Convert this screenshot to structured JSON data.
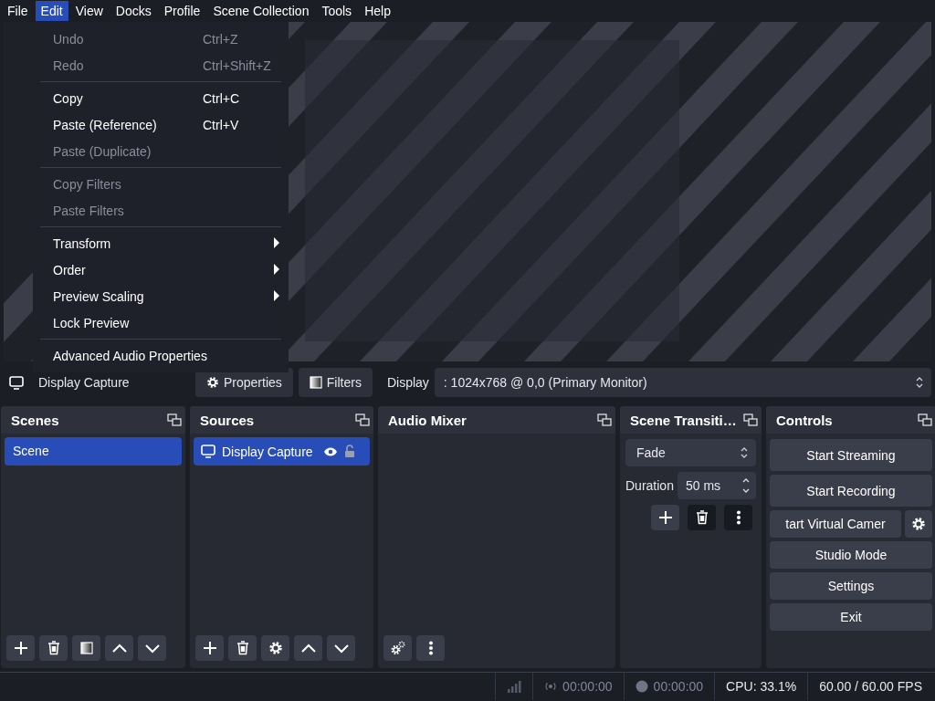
{
  "menubar": [
    {
      "label": "File",
      "selected": false
    },
    {
      "label": "Edit",
      "selected": true
    },
    {
      "label": "View",
      "selected": false
    },
    {
      "label": "Docks",
      "selected": false
    },
    {
      "label": "Profile",
      "selected": false
    },
    {
      "label": "Scene Collection",
      "selected": false
    },
    {
      "label": "Tools",
      "selected": false
    },
    {
      "label": "Help",
      "selected": false
    }
  ],
  "edit_menu": {
    "items": [
      {
        "kind": "item",
        "label": "Undo",
        "shortcut": "Ctrl+Z",
        "disabled": true,
        "submenu": false
      },
      {
        "kind": "item",
        "label": "Redo",
        "shortcut": "Ctrl+Shift+Z",
        "disabled": true,
        "submenu": false
      },
      {
        "kind": "separator"
      },
      {
        "kind": "item",
        "label": "Copy",
        "shortcut": "Ctrl+C",
        "disabled": false,
        "submenu": false
      },
      {
        "kind": "item",
        "label": "Paste (Reference)",
        "shortcut": "Ctrl+V",
        "disabled": false,
        "submenu": false
      },
      {
        "kind": "item",
        "label": "Paste (Duplicate)",
        "disabled": true,
        "submenu": false
      },
      {
        "kind": "separator"
      },
      {
        "kind": "item",
        "label": "Copy Filters",
        "disabled": true,
        "submenu": false
      },
      {
        "kind": "item",
        "label": "Paste Filters",
        "disabled": true,
        "submenu": false
      },
      {
        "kind": "separator"
      },
      {
        "kind": "item",
        "label": "Transform",
        "disabled": false,
        "submenu": true
      },
      {
        "kind": "item",
        "label": "Order",
        "disabled": false,
        "submenu": true
      },
      {
        "kind": "item",
        "label": "Preview Scaling",
        "disabled": false,
        "submenu": true
      },
      {
        "kind": "item",
        "label": "Lock Preview",
        "disabled": false,
        "submenu": false
      },
      {
        "kind": "separator"
      },
      {
        "kind": "item",
        "label": "Advanced Audio Properties",
        "disabled": false,
        "submenu": false
      }
    ]
  },
  "source_toolbar": {
    "source_name": "Display Capture",
    "properties_button": "Properties",
    "filters_button": "Filters",
    "display_label": "Display",
    "display_value": ": 1024x768 @ 0,0 (Primary Monitor)"
  },
  "docks": {
    "scenes": {
      "title": "Scenes",
      "items": [
        {
          "label": "Scene",
          "selected": true
        }
      ]
    },
    "sources": {
      "title": "Sources",
      "items": [
        {
          "label": "Display Capture",
          "selected": true,
          "visible": true,
          "locked": false
        }
      ]
    },
    "audio_mixer": {
      "title": "Audio Mixer"
    },
    "scene_transitions": {
      "title": "Scene Transiti…",
      "transition": "Fade",
      "duration_label": "Duration",
      "duration": "50 ms"
    },
    "controls": {
      "title": "Controls",
      "buttons": [
        {
          "kind": "button",
          "label": "Start Streaming"
        },
        {
          "kind": "button",
          "label": "Start Recording"
        },
        {
          "kind": "with_settings",
          "label": "tart Virtual Camer"
        },
        {
          "kind": "button",
          "label": "Studio Mode"
        },
        {
          "kind": "button",
          "label": "Settings"
        },
        {
          "kind": "button",
          "label": "Exit"
        }
      ]
    }
  },
  "status_bar": {
    "stream_time": "00:00:00",
    "record_time": "00:00:00",
    "cpu": "CPU: 33.1%",
    "fps": "60.00 / 60.00 FPS"
  }
}
